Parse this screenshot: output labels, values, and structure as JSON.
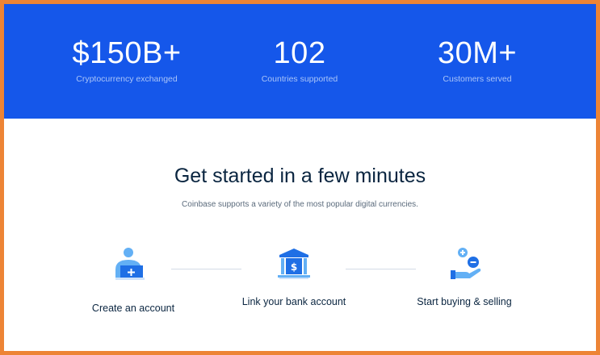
{
  "stats": [
    {
      "value": "$150B+",
      "caption": "Cryptocurrency exchanged"
    },
    {
      "value": "102",
      "caption": "Countries supported"
    },
    {
      "value": "30M+",
      "caption": "Customers served"
    }
  ],
  "get_started": {
    "heading": "Get started in a few minutes",
    "subheading": "Coinbase supports a variety of the most popular digital currencies.",
    "steps": [
      {
        "label": "Create an account",
        "icon": "add-user-icon"
      },
      {
        "label": "Link your bank account",
        "icon": "bank-icon"
      },
      {
        "label": "Start buying & selling",
        "icon": "hand-coins-icon"
      }
    ]
  },
  "colors": {
    "banner_blue": "#1557ea",
    "frame_orange": "#ed8435",
    "heading_navy": "#0a2540",
    "icon_blue": "#1f6fe5",
    "icon_light_blue": "#63b0f5"
  }
}
